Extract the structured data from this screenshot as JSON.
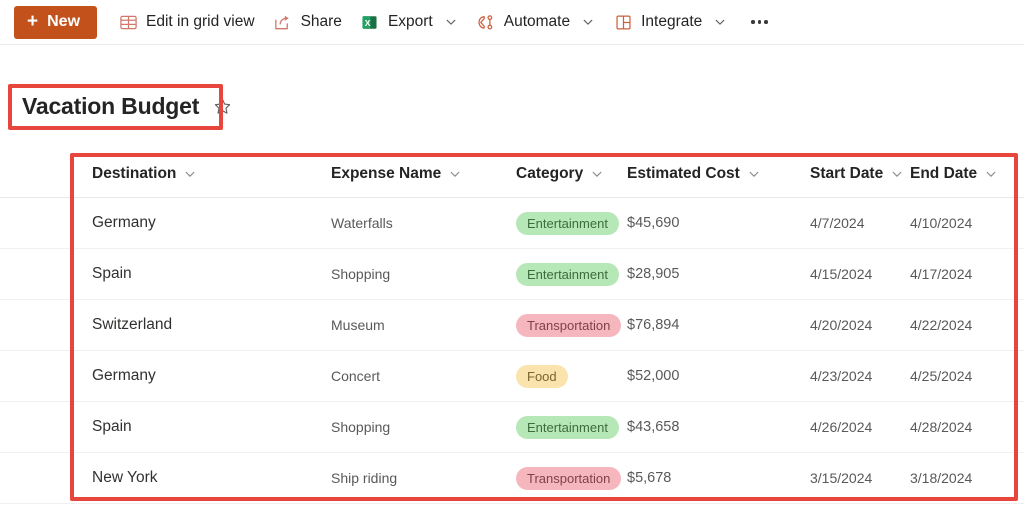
{
  "commandbar": {
    "new_label": "New",
    "new_icon": "plus-icon",
    "new_color": "#c2511c",
    "items": [
      {
        "label": "Edit in grid view",
        "icon": "grid-table-icon",
        "has_chevron": false
      },
      {
        "label": "Share",
        "icon": "share-icon",
        "has_chevron": false
      },
      {
        "label": "Export",
        "icon": "excel-icon",
        "has_chevron": true
      },
      {
        "label": "Automate",
        "icon": "automate-flow-icon",
        "has_chevron": true
      },
      {
        "label": "Integrate",
        "icon": "integrate-blocks-icon",
        "has_chevron": true
      }
    ],
    "overflow_label": "More options",
    "overflow_icon": "ellipsis-icon"
  },
  "header": {
    "title": "Vacation Budget",
    "favorite_icon": "star-outline-icon"
  },
  "annotations": {
    "color": "#e8453c",
    "title_box": "highlight-title",
    "table_box": "highlight-table"
  },
  "table": {
    "columns": [
      {
        "label": "Destination",
        "sort_icon": "chevron-down-icon"
      },
      {
        "label": "Expense Name",
        "sort_icon": "chevron-down-icon"
      },
      {
        "label": "Category",
        "sort_icon": "chevron-down-icon"
      },
      {
        "label": "Estimated Cost",
        "sort_icon": "chevron-down-icon"
      },
      {
        "label": "Start Date",
        "sort_icon": "chevron-down-icon"
      },
      {
        "label": "End Date",
        "sort_icon": "chevron-down-icon"
      }
    ],
    "rows": [
      {
        "destination": "Germany",
        "expense_name": "Waterfalls",
        "category": "Entertainment",
        "category_style": "entertainment",
        "estimated_cost": "$45,690",
        "start_date": "4/7/2024",
        "end_date": "4/10/2024"
      },
      {
        "destination": "Spain",
        "expense_name": "Shopping",
        "category": "Entertainment",
        "category_style": "entertainment",
        "estimated_cost": "$28,905",
        "start_date": "4/15/2024",
        "end_date": "4/17/2024"
      },
      {
        "destination": "Switzerland",
        "expense_name": "Museum",
        "category": "Transportation",
        "category_style": "transportation",
        "estimated_cost": "$76,894",
        "start_date": "4/20/2024",
        "end_date": "4/22/2024"
      },
      {
        "destination": "Germany",
        "expense_name": "Concert",
        "category": "Food",
        "category_style": "food",
        "estimated_cost": "$52,000",
        "start_date": "4/23/2024",
        "end_date": "4/25/2024"
      },
      {
        "destination": "Spain",
        "expense_name": "Shopping",
        "category": "Entertainment",
        "category_style": "entertainment",
        "estimated_cost": "$43,658",
        "start_date": "4/26/2024",
        "end_date": "4/28/2024"
      },
      {
        "destination": "New York",
        "expense_name": "Ship riding",
        "category": "Transportation",
        "category_style": "transportation",
        "estimated_cost": "$5,678",
        "start_date": "3/15/2024",
        "end_date": "3/18/2024"
      }
    ],
    "category_colors": {
      "entertainment": "#b6e7b6",
      "transportation": "#f5b7bd",
      "food": "#fae3ad"
    }
  }
}
